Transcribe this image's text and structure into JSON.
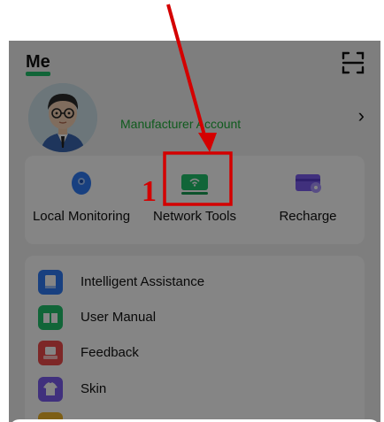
{
  "page": {
    "title": "Me",
    "account_label": "Manufacturer Account",
    "account_chevron": "›"
  },
  "tools": [
    {
      "label": "Local Monitoring",
      "icon": "camera-icon",
      "color": "#2f7cf6"
    },
    {
      "label": "Network Tools",
      "icon": "router-icon",
      "color": "#22c26b"
    },
    {
      "label": "Recharge",
      "icon": "wallet-card-icon",
      "color": "#7b5cf0"
    }
  ],
  "menu": [
    {
      "label": "Intelligent Assistance",
      "icon": "assistant-book-icon",
      "color": "#2f7cf6"
    },
    {
      "label": "User Manual",
      "icon": "manual-book-icon",
      "color": "#22c26b"
    },
    {
      "label": "Feedback",
      "icon": "feedback-icon",
      "color": "#ef4b4b"
    },
    {
      "label": "Skin",
      "icon": "shirt-icon",
      "color": "#7b5cf0"
    }
  ],
  "annotation": {
    "step_number": "1",
    "color": "#d40000"
  }
}
